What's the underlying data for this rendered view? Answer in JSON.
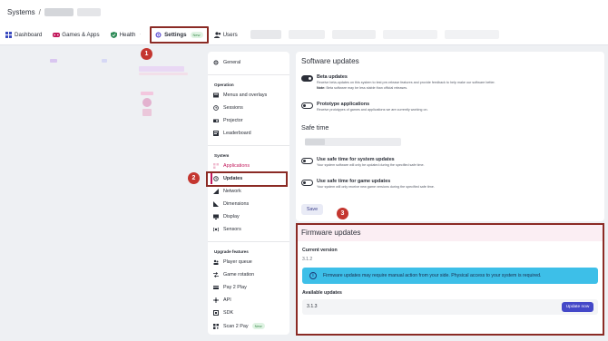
{
  "breadcrumb": {
    "root": "Systems",
    "separator": "/"
  },
  "tabs": [
    {
      "label": "Dashboard",
      "icon": "grid-icon"
    },
    {
      "label": "Games & Apps",
      "icon": "gamepad-icon"
    },
    {
      "label": "Health",
      "icon": "shield-check-icon"
    },
    {
      "label": "Settings",
      "icon": "gear-icon",
      "badge": "New"
    },
    {
      "label": "Users",
      "icon": "users-icon"
    }
  ],
  "markers": [
    "1",
    "2",
    "3"
  ],
  "sidebar": {
    "general": "General",
    "operation_heading": "Operation",
    "operation_items": [
      "Menus and overlays",
      "Sessions",
      "Projector",
      "Leaderboard"
    ],
    "system_heading": "System",
    "system_items": [
      "Applications",
      "Updates",
      "Network",
      "Dimensions",
      "Display",
      "Sensors"
    ],
    "upgrade_heading": "Upgrade features",
    "upgrade_items": [
      "Player queue",
      "Game rotation",
      "Pay 2 Play",
      "API",
      "SDK",
      "Scan 2 Pay"
    ],
    "scan_badge": "New"
  },
  "software_updates": {
    "title": "Software updates",
    "beta": {
      "title": "Beta updates",
      "desc": "Receive beta-updates on this system to test pre-release features and provide feedback to help make our software better.",
      "note_label": "Note:",
      "note": "Beta software may be less stable than official releases."
    },
    "prototype": {
      "title": "Prototype applications",
      "desc": "Receive prototypes of games and applications we are currently working on."
    },
    "safe_time_title": "Safe time",
    "safe_system": {
      "title": "Use safe time for system updates",
      "desc": "Your system software will only be updated during the specified safe time."
    },
    "safe_game": {
      "title": "Use safe time for game updates",
      "desc": "Your system will only receive new game versions during the specified safe time."
    },
    "save_label": "Save"
  },
  "firmware": {
    "title": "Firmware updates",
    "current_label": "Current version",
    "current_value": "3.1.2",
    "info": "Firmware updates may require manual action from your side. Physical access to your system is required.",
    "available_label": "Available updates",
    "available_value": "3.1.3",
    "update_label": "Update now"
  }
}
